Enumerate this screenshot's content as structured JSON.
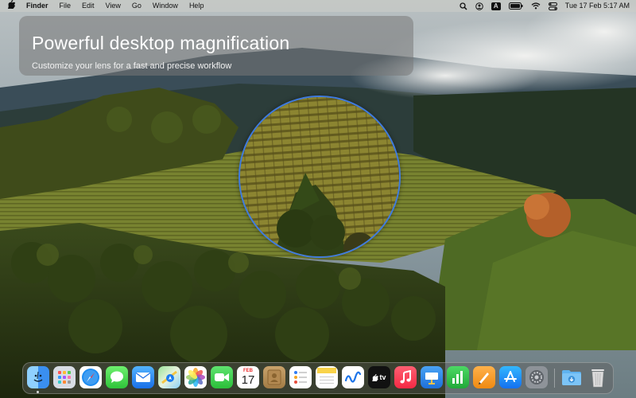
{
  "menubar": {
    "apple_icon": "apple-icon",
    "app_name": "Finder",
    "menus": [
      "File",
      "Edit",
      "View",
      "Go",
      "Window",
      "Help"
    ],
    "status": {
      "search_icon": "search-icon",
      "user_icon": "user-icon",
      "input_source": "A",
      "battery_icon": "battery-icon",
      "wifi_icon": "wifi-icon",
      "control_center_icon": "control-center-icon",
      "datetime": "Tue 17 Feb  5:17 AM"
    }
  },
  "banner": {
    "title": "Powerful desktop magnification",
    "subtitle": "Customize your lens for a fast and precise workflow"
  },
  "lens": {
    "border_color": "#3f7be0"
  },
  "dock": {
    "apps": [
      {
        "name": "Finder",
        "icon": "finder-icon",
        "running": true
      },
      {
        "name": "Launchpad",
        "icon": "launchpad-icon"
      },
      {
        "name": "Safari",
        "icon": "safari-icon"
      },
      {
        "name": "Messages",
        "icon": "messages-icon"
      },
      {
        "name": "Mail",
        "icon": "mail-icon"
      },
      {
        "name": "Maps",
        "icon": "maps-icon"
      },
      {
        "name": "Photos",
        "icon": "photos-icon"
      },
      {
        "name": "FaceTime",
        "icon": "facetime-icon"
      },
      {
        "name": "Calendar",
        "icon": "calendar-icon",
        "month": "FEB",
        "day": "17"
      },
      {
        "name": "Contacts",
        "icon": "contacts-icon"
      },
      {
        "name": "Reminders",
        "icon": "reminders-icon"
      },
      {
        "name": "Notes",
        "icon": "notes-icon"
      },
      {
        "name": "Freeform",
        "icon": "freeform-icon"
      },
      {
        "name": "TV",
        "icon": "tv-icon",
        "label": "tv"
      },
      {
        "name": "Music",
        "icon": "music-icon"
      },
      {
        "name": "Keynote",
        "icon": "keynote-icon"
      },
      {
        "name": "Numbers",
        "icon": "numbers-icon"
      },
      {
        "name": "Pages",
        "icon": "pages-icon"
      },
      {
        "name": "App Store",
        "icon": "app-store-icon"
      },
      {
        "name": "System Settings",
        "icon": "system-settings-icon"
      },
      {
        "name": "Downloads",
        "icon": "downloads-folder-icon"
      },
      {
        "name": "Trash",
        "icon": "trash-icon"
      }
    ]
  }
}
